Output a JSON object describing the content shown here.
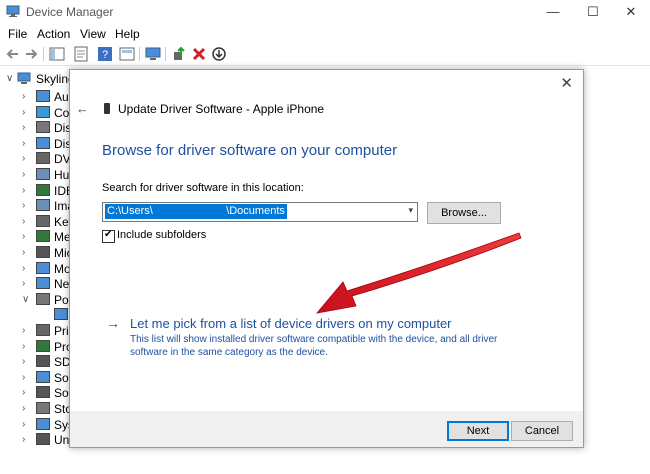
{
  "window": {
    "title": "Device Manager",
    "icon": "device-manager-icon",
    "minimize": "—",
    "maximize": "☐",
    "close": "✕"
  },
  "menu": [
    "File",
    "Action",
    "View",
    "Help"
  ],
  "toolbar": {
    "icons": [
      "back-icon",
      "forward-icon",
      "show-hide-icon",
      "properties-icon",
      "help-icon",
      "view-icon",
      "scan-hardware-icon",
      "update-driver-icon",
      "uninstall-icon",
      "disable-icon"
    ]
  },
  "tree": {
    "root": "Skyline",
    "items": [
      "Aud",
      "Cor",
      "Disk",
      "Disp",
      "DVD",
      "Hur",
      "IDE",
      "Ima",
      "Key",
      "Mer",
      "Mic",
      "Mo",
      "Net",
      "Por",
      "",
      "Prin",
      "Pro",
      "SD H",
      "Soft",
      "Sou",
      "Stor",
      "Syst",
      "Uni"
    ]
  },
  "dialog": {
    "title": "Update Driver Software - Apple iPhone",
    "heading": "Browse for driver software on your computer",
    "search_label": "Search for driver software in this location:",
    "path_value": "C:\\Users\\                        \\Documents",
    "browse_label": "Browse...",
    "include_subfolders_label": "Include subfolders",
    "include_subfolders_checked": true,
    "pick_link_arrow": "→",
    "pick_link_text": "Let me pick from a list of device drivers on my computer",
    "pick_link_description": "This list will show installed driver software compatible with the device, and all driver software in the same category as the device.",
    "next_label": "Next",
    "cancel_label": "Cancel",
    "close": "✕",
    "back": "←"
  },
  "colors": {
    "link_blue": "#1e50a2",
    "selection_blue": "#0078d7",
    "annotation_red": "#e0202a"
  }
}
